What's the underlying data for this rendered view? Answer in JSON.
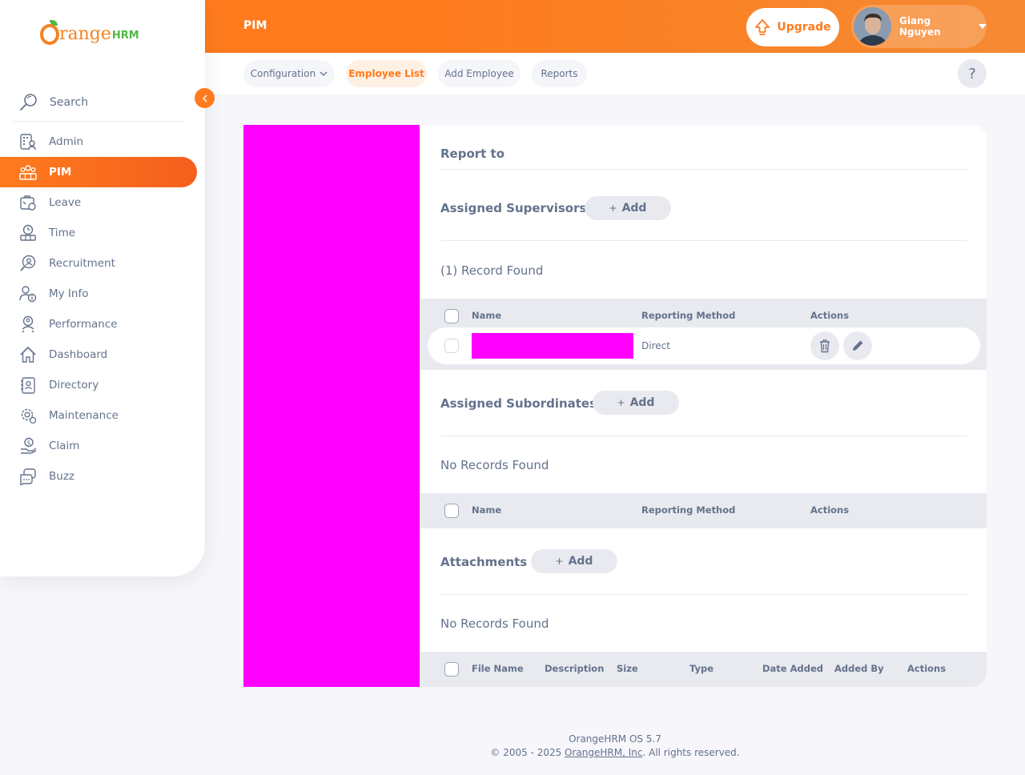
{
  "header": {
    "module_title": "PIM",
    "upgrade_label": "Upgrade",
    "user_name": "Giang Nguyen"
  },
  "subnav": {
    "tabs": [
      {
        "label": "Configuration",
        "dropdown": true
      },
      {
        "label": "Employee List",
        "active": true
      },
      {
        "label": "Add Employee"
      },
      {
        "label": "Reports"
      }
    ],
    "help_label": "?"
  },
  "sidebar": {
    "logo_text": "range",
    "logo_suffix": "HRM",
    "search_label": "Search",
    "items": [
      {
        "label": "Admin",
        "icon": "admin-icon"
      },
      {
        "label": "PIM",
        "icon": "pim-icon",
        "active": true
      },
      {
        "label": "Leave",
        "icon": "leave-icon"
      },
      {
        "label": "Time",
        "icon": "time-icon"
      },
      {
        "label": "Recruitment",
        "icon": "recruitment-icon"
      },
      {
        "label": "My Info",
        "icon": "my-info-icon"
      },
      {
        "label": "Performance",
        "icon": "performance-icon"
      },
      {
        "label": "Dashboard",
        "icon": "dashboard-icon"
      },
      {
        "label": "Directory",
        "icon": "directory-icon"
      },
      {
        "label": "Maintenance",
        "icon": "maintenance-icon"
      },
      {
        "label": "Claim",
        "icon": "claim-icon"
      },
      {
        "label": "Buzz",
        "icon": "buzz-icon"
      }
    ]
  },
  "report_to": {
    "title": "Report to",
    "supervisors": {
      "title": "Assigned Supervisors",
      "add_label": "Add",
      "records_text": "(1) Record Found",
      "columns": [
        "Name",
        "Reporting Method",
        "Actions"
      ],
      "rows": [
        {
          "reporting_method": "Direct"
        }
      ]
    },
    "subordinates": {
      "title": "Assigned Subordinates",
      "add_label": "Add",
      "records_text": "No Records Found",
      "columns": [
        "Name",
        "Reporting Method",
        "Actions"
      ]
    },
    "attachments": {
      "title": "Attachments",
      "add_label": "Add",
      "records_text": "No Records Found",
      "columns": [
        "File Name",
        "Description",
        "Size",
        "Type",
        "Date Added",
        "Added By",
        "Actions"
      ]
    }
  },
  "footer": {
    "version": "OrangeHRM OS 5.7",
    "copyright_prefix": "© 2005 - 2025 ",
    "company_link": "OrangeHRM, Inc",
    "copyright_suffix": ". All rights reserved."
  },
  "colors": {
    "brand_orange": "#ff7b1d",
    "brand_green": "#52b848",
    "text": "#64728c",
    "redaction": "#ff00ff"
  }
}
